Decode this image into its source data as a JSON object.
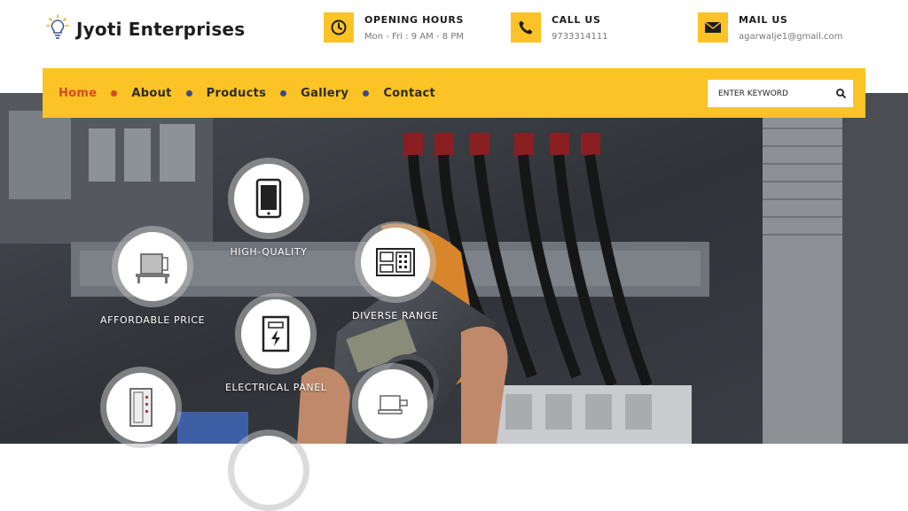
{
  "brand": {
    "name": "Jyoti Enterprises",
    "logo_icon": "lightbulb-icon"
  },
  "header_info": [
    {
      "title": "OPENING HOURS",
      "value": "Mon - Fri : 9 AM - 8 PM",
      "icon": "clock-icon"
    },
    {
      "title": "CALL US",
      "value": "9733314111",
      "icon": "phone-icon"
    },
    {
      "title": "MAIL US",
      "value": "agarwalje1@gmail.com",
      "icon": "envelope-icon"
    }
  ],
  "nav": {
    "items": [
      "Home",
      "About",
      "Products",
      "Gallery",
      "Contact"
    ],
    "active": "Home"
  },
  "search": {
    "placeholder": "ENTER KEYWORD",
    "value": ""
  },
  "features": [
    {
      "label": "HIGH-QUALITY",
      "icon": "smartphone-icon"
    },
    {
      "label": "AFFORDABLE PRICE",
      "icon": "machine-icon"
    },
    {
      "label": "DIVERSE RANGE",
      "icon": "control-panel-icon"
    },
    {
      "label": "ELECTRICAL PANEL",
      "icon": "electrical-panel-icon"
    },
    {
      "label": "",
      "icon": "cabinet-icon"
    },
    {
      "label": "",
      "icon": "motor-icon"
    }
  ],
  "colors": {
    "accent": "#fbc325",
    "active": "#d9472b",
    "text": "#1d1d1d"
  }
}
